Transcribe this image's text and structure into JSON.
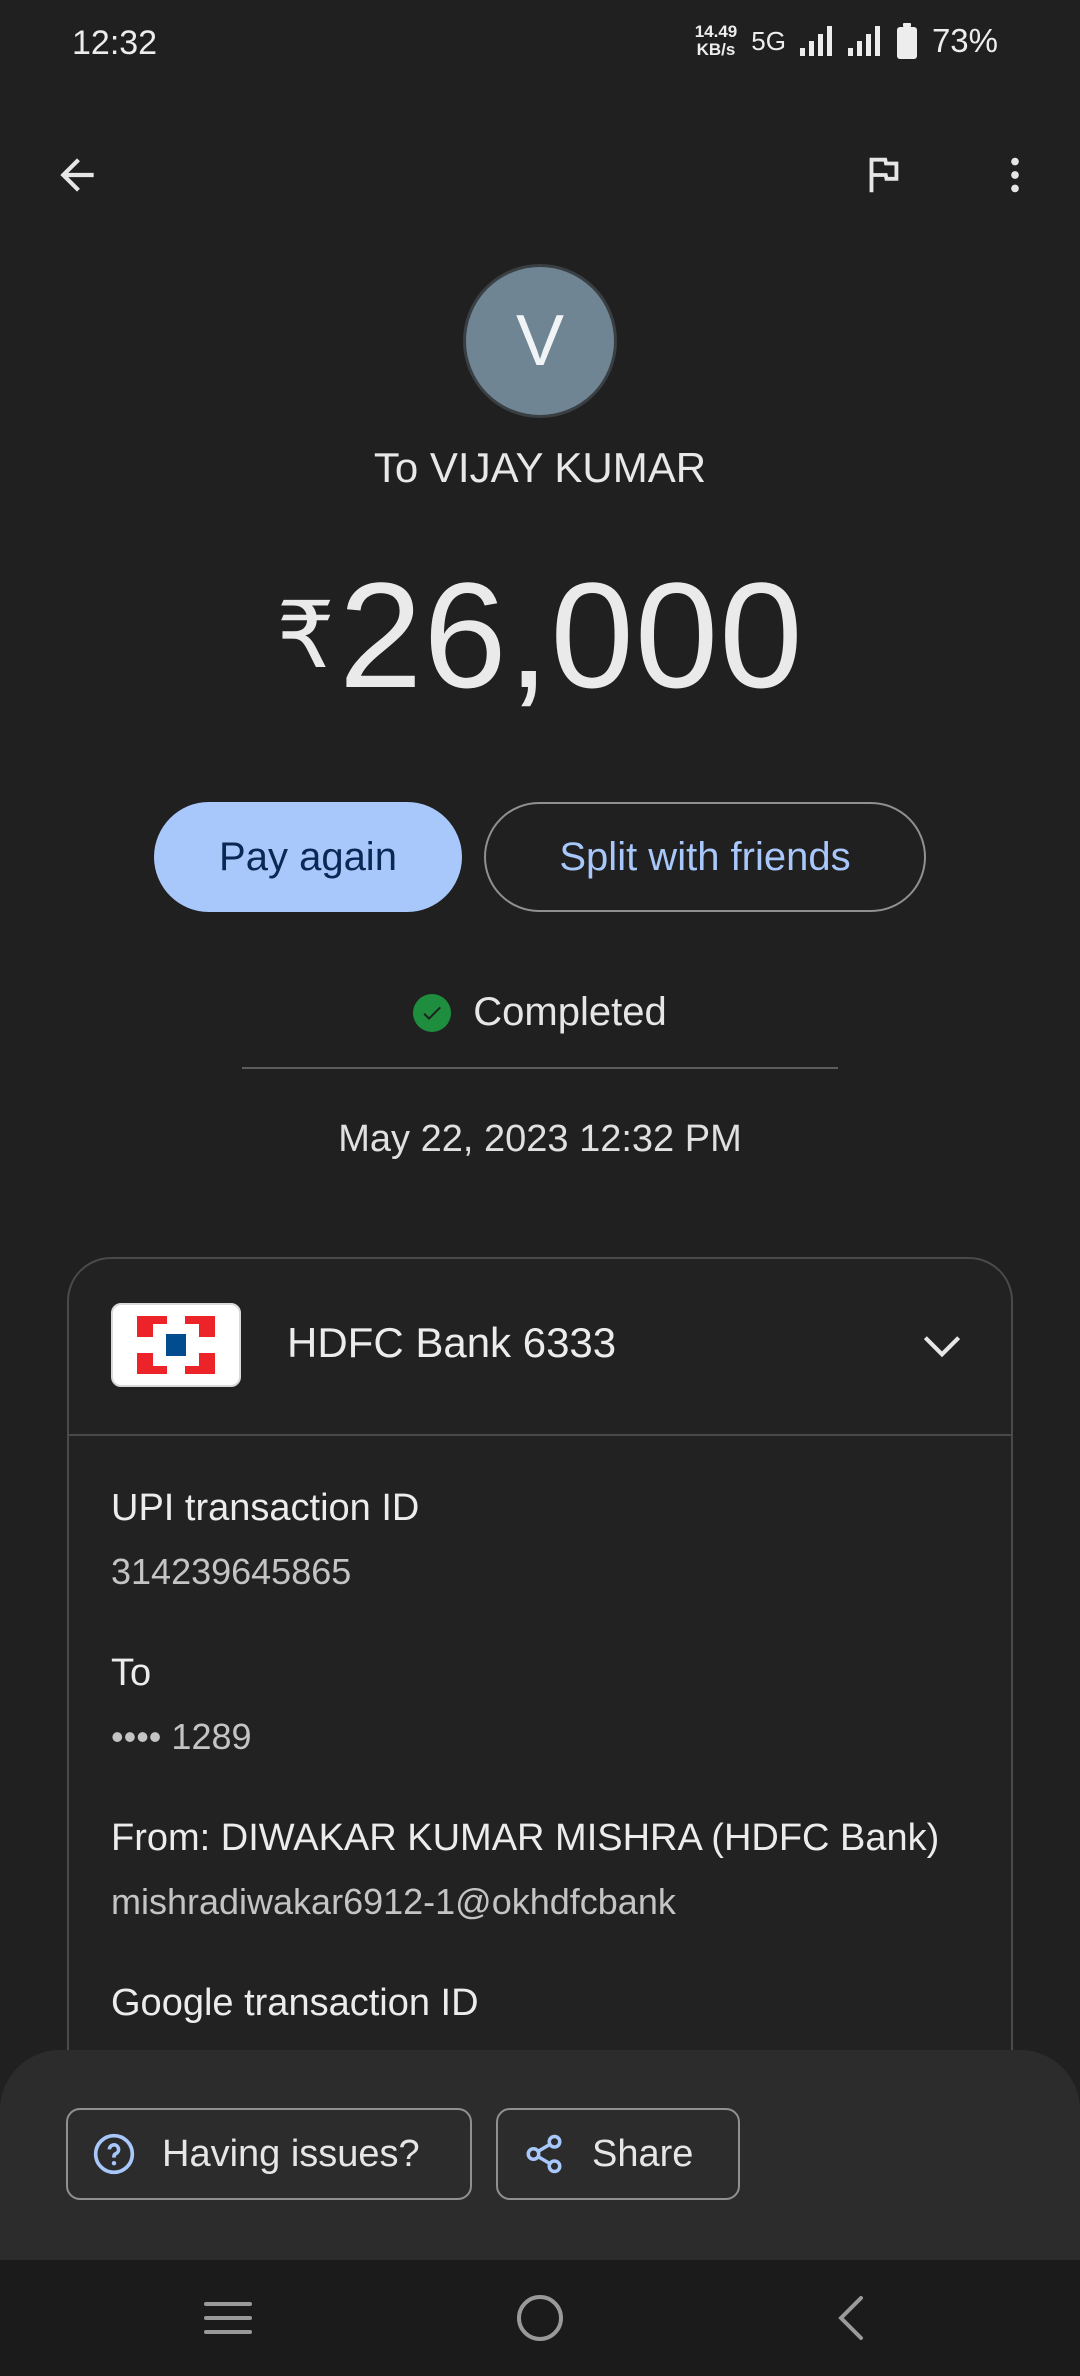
{
  "status_bar": {
    "time": "12:32",
    "net_speed_value": "14.49",
    "net_speed_unit": "KB/s",
    "network": "5G",
    "battery": "73%"
  },
  "header": {
    "back_icon": "arrow-left-icon",
    "flag_icon": "flag-icon",
    "more_icon": "more-vert-icon"
  },
  "payee": {
    "avatar_initial": "V",
    "title": "To VIJAY KUMAR"
  },
  "amount": {
    "currency": "₹",
    "value": "26,000"
  },
  "actions": {
    "pay_again": "Pay again",
    "split": "Split with friends"
  },
  "status": {
    "label": "Completed",
    "color": "#1e8e3e"
  },
  "datetime": "May 22, 2023 12:32 PM",
  "card": {
    "bank_name": "HDFC Bank 6333",
    "details": [
      {
        "label": "UPI transaction ID",
        "value": "314239645865"
      },
      {
        "label": "To",
        "value": "•••• 1289"
      },
      {
        "label": "From: DIWAKAR KUMAR MISHRA (HDFC Bank)",
        "value": "mishradiwakar6912-1@okhdfcbank"
      },
      {
        "label": "Google transaction ID",
        "value": ""
      }
    ]
  },
  "bottom_actions": {
    "issues": "Having issues?",
    "share": "Share"
  },
  "colors": {
    "accent": "#a8c7fa",
    "background": "#202020"
  }
}
